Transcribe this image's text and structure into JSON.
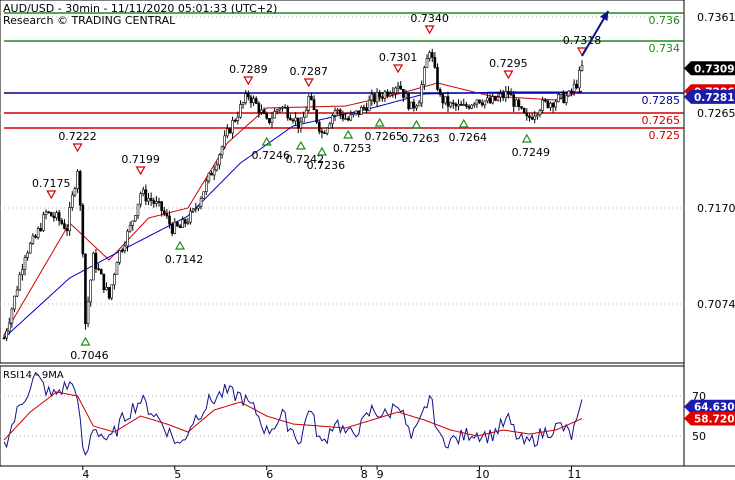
{
  "chart_data": [
    {
      "type": "candlestick",
      "header": {
        "title": "AUD/USD - 30min - 11/11/2020 05:01:33 (UTC+2)",
        "subtitle": "Research © TRADING CENTRAL"
      },
      "y_axis": {
        "ylim": [
          0.7015,
          0.7378
        ],
        "ticks": [
          "0.7361",
          "0.7265",
          "0.7170",
          "0.7074"
        ],
        "position": "right",
        "grid": "dotted-horizontal"
      },
      "x_axis": {
        "labels": [
          "4",
          "5",
          "6",
          "8",
          "9",
          "10",
          "11"
        ],
        "label_positions_bar_index": [
          30,
          65,
          100,
          136,
          142,
          181,
          216
        ]
      },
      "price_tags": [
        {
          "label": "0.73097",
          "value": 0.73097,
          "bg": "#000000",
          "fg": "#ffffff"
        },
        {
          "label": "0.72867",
          "value": 0.72867,
          "bg": "#e00000",
          "fg": "#ffffff"
        },
        {
          "label": "0.72811",
          "value": 0.72811,
          "bg": "#1c1caa",
          "fg": "#ffffff"
        }
      ],
      "horizontal_levels": [
        {
          "label": "0.736",
          "value": 0.7365,
          "color": "#1f8a1f"
        },
        {
          "label": "0.734",
          "value": 0.7337,
          "color": "#1f8a1f"
        },
        {
          "label": "0.7285",
          "value": 0.7285,
          "color": "#00008b"
        },
        {
          "label": "0.7265",
          "value": 0.7265,
          "color": "#d00000"
        },
        {
          "label": "0.725",
          "value": 0.725,
          "color": "#d00000"
        }
      ],
      "target_arrow": {
        "from_bar": 220,
        "from_value": 0.7322,
        "to_bar": 230,
        "to_value": 0.7367,
        "color": "#10108a"
      },
      "swing_highs": [
        {
          "label": "0.7175",
          "bar": 18,
          "value": 0.7175
        },
        {
          "label": "0.7222",
          "bar": 28,
          "value": 0.7222
        },
        {
          "label": "0.7199",
          "bar": 52,
          "value": 0.7199
        },
        {
          "label": "0.7289",
          "bar": 93,
          "value": 0.7289
        },
        {
          "label": "0.7287",
          "bar": 116,
          "value": 0.7287
        },
        {
          "label": "0.7301",
          "bar": 150,
          "value": 0.7301
        },
        {
          "label": "0.7340",
          "bar": 162,
          "value": 0.734
        },
        {
          "label": "0.7295",
          "bar": 192,
          "value": 0.7295
        },
        {
          "label": "0.7318",
          "bar": 220,
          "value": 0.7318
        }
      ],
      "swing_lows": [
        {
          "label": "0.7046",
          "bar": 31,
          "value": 0.7046
        },
        {
          "label": "0.7142",
          "bar": 67,
          "value": 0.7142
        },
        {
          "label": "0.7246",
          "bar": 100,
          "value": 0.7246
        },
        {
          "label": "0.7242",
          "bar": 113,
          "value": 0.7242
        },
        {
          "label": "0.7236",
          "bar": 121,
          "value": 0.7236
        },
        {
          "label": "0.7253",
          "bar": 131,
          "value": 0.7253
        },
        {
          "label": "0.7265",
          "bar": 143,
          "value": 0.7265
        },
        {
          "label": "0.7263",
          "bar": 157,
          "value": 0.7263
        },
        {
          "label": "0.7264",
          "bar": 175,
          "value": 0.7264
        },
        {
          "label": "0.7249",
          "bar": 199,
          "value": 0.7249
        }
      ],
      "moving_averages": [
        {
          "color": "#cc0000",
          "anchors": [
            [
              0,
              0.7043
            ],
            [
              25,
              0.7155
            ],
            [
              40,
              0.7118
            ],
            [
              55,
              0.716
            ],
            [
              70,
              0.717
            ],
            [
              85,
              0.7235
            ],
            [
              100,
              0.727
            ],
            [
              130,
              0.7272
            ],
            [
              150,
              0.7284
            ],
            [
              165,
              0.7295
            ],
            [
              185,
              0.7282
            ],
            [
              210,
              0.7278
            ],
            [
              220,
              0.7287
            ]
          ]
        },
        {
          "color": "#0000cc",
          "anchors": [
            [
              0,
              0.704
            ],
            [
              25,
              0.71
            ],
            [
              45,
              0.7128
            ],
            [
              70,
              0.7162
            ],
            [
              90,
              0.7215
            ],
            [
              110,
              0.7252
            ],
            [
              140,
              0.727
            ],
            [
              160,
              0.7284
            ],
            [
              190,
              0.7286
            ],
            [
              220,
              0.7286
            ]
          ]
        }
      ],
      "close_anchors": [
        [
          0,
          0.704
        ],
        [
          4,
          0.708
        ],
        [
          8,
          0.7125
        ],
        [
          12,
          0.714
        ],
        [
          16,
          0.7165
        ],
        [
          20,
          0.716
        ],
        [
          24,
          0.715
        ],
        [
          27,
          0.7195
        ],
        [
          28,
          0.721
        ],
        [
          30,
          0.713
        ],
        [
          31,
          0.7055
        ],
        [
          34,
          0.712
        ],
        [
          37,
          0.71
        ],
        [
          40,
          0.708
        ],
        [
          43,
          0.712
        ],
        [
          48,
          0.715
        ],
        [
          52,
          0.7185
        ],
        [
          56,
          0.7178
        ],
        [
          60,
          0.7168
        ],
        [
          64,
          0.715
        ],
        [
          67,
          0.715
        ],
        [
          72,
          0.7165
        ],
        [
          78,
          0.72
        ],
        [
          82,
          0.7225
        ],
        [
          86,
          0.725
        ],
        [
          90,
          0.727
        ],
        [
          93,
          0.7283
        ],
        [
          97,
          0.727
        ],
        [
          100,
          0.7255
        ],
        [
          105,
          0.7272
        ],
        [
          110,
          0.7262
        ],
        [
          113,
          0.725
        ],
        [
          116,
          0.728
        ],
        [
          121,
          0.7245
        ],
        [
          126,
          0.7268
        ],
        [
          131,
          0.7258
        ],
        [
          136,
          0.7268
        ],
        [
          140,
          0.7278
        ],
        [
          145,
          0.7285
        ],
        [
          150,
          0.7295
        ],
        [
          155,
          0.727
        ],
        [
          158,
          0.728
        ],
        [
          162,
          0.733
        ],
        [
          166,
          0.728
        ],
        [
          170,
          0.7272
        ],
        [
          175,
          0.727
        ],
        [
          180,
          0.728
        ],
        [
          185,
          0.7275
        ],
        [
          192,
          0.7285
        ],
        [
          196,
          0.7268
        ],
        [
          199,
          0.7258
        ],
        [
          204,
          0.7272
        ],
        [
          210,
          0.7278
        ],
        [
          215,
          0.7282
        ],
        [
          218,
          0.7295
        ],
        [
          220,
          0.731
        ]
      ],
      "bar_count": 221
    },
    {
      "type": "line",
      "title": "RSI14 - 9MA",
      "y_axis": {
        "ylim": [
          35,
          85
        ],
        "ticks": [
          "70",
          "50"
        ],
        "grid": "dotted-horizontal"
      },
      "price_tags": [
        {
          "label": "64.6303",
          "value": 64.63,
          "bg": "#1c1caa",
          "fg": "#ffffff"
        },
        {
          "label": "58.7206",
          "value": 58.72,
          "bg": "#e00000",
          "fg": "#ffffff"
        }
      ],
      "series": [
        {
          "name": "RSI14",
          "color": "#10108a",
          "anchors": [
            [
              0,
              45
            ],
            [
              6,
              65
            ],
            [
              12,
              80
            ],
            [
              18,
              70
            ],
            [
              24,
              75
            ],
            [
              27,
              76
            ],
            [
              30,
              45
            ],
            [
              31,
              38
            ],
            [
              34,
              55
            ],
            [
              40,
              47
            ],
            [
              46,
              60
            ],
            [
              52,
              68
            ],
            [
              58,
              60
            ],
            [
              64,
              50
            ],
            [
              67,
              45
            ],
            [
              72,
              58
            ],
            [
              78,
              67
            ],
            [
              84,
              72
            ],
            [
              90,
              70
            ],
            [
              96,
              62
            ],
            [
              100,
              52
            ],
            [
              106,
              60
            ],
            [
              113,
              47
            ],
            [
              116,
              65
            ],
            [
              121,
              45
            ],
            [
              126,
              58
            ],
            [
              131,
              50
            ],
            [
              136,
              55
            ],
            [
              140,
              63
            ],
            [
              146,
              60
            ],
            [
              150,
              68
            ],
            [
              155,
              48
            ],
            [
              158,
              55
            ],
            [
              162,
              70
            ],
            [
              166,
              48
            ],
            [
              172,
              48
            ],
            [
              178,
              52
            ],
            [
              185,
              50
            ],
            [
              192,
              58
            ],
            [
              196,
              48
            ],
            [
              199,
              46
            ],
            [
              206,
              52
            ],
            [
              212,
              55
            ],
            [
              216,
              50
            ],
            [
              219,
              60
            ],
            [
              220,
              64.6
            ]
          ]
        },
        {
          "name": "9MA",
          "color": "#cc0000",
          "anchors": [
            [
              0,
              48
            ],
            [
              10,
              62
            ],
            [
              20,
              72
            ],
            [
              28,
              70
            ],
            [
              34,
              55
            ],
            [
              42,
              52
            ],
            [
              52,
              60
            ],
            [
              62,
              56
            ],
            [
              70,
              52
            ],
            [
              80,
              63
            ],
            [
              90,
              67
            ],
            [
              100,
              60
            ],
            [
              110,
              56
            ],
            [
              120,
              55
            ],
            [
              130,
              54
            ],
            [
              140,
              58
            ],
            [
              150,
              62
            ],
            [
              160,
              58
            ],
            [
              170,
              53
            ],
            [
              180,
              50
            ],
            [
              190,
              53
            ],
            [
              200,
              51
            ],
            [
              210,
              53
            ],
            [
              220,
              58.7
            ]
          ]
        }
      ]
    }
  ]
}
